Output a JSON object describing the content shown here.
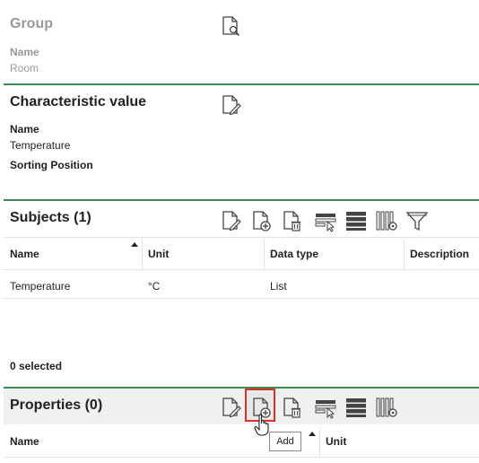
{
  "group": {
    "title": "Group",
    "name_label": "Name",
    "name_value": "Room"
  },
  "characteristic": {
    "title": "Characteristic value",
    "name_label": "Name",
    "name_value": "Temperature",
    "sorting_label": "Sorting Position"
  },
  "subjects": {
    "title": "Subjects (1)",
    "columns": [
      "Name",
      "Unit",
      "Data type",
      "Description"
    ],
    "rows": [
      {
        "name": "Temperature",
        "unit": "°C",
        "data_type": "List",
        "description": ""
      }
    ],
    "selected_text": "0 selected"
  },
  "properties": {
    "title": "Properties (0)",
    "columns": [
      "Name",
      "Unit"
    ],
    "tooltip": "Add"
  },
  "colors": {
    "accent_line": "#3a8a52",
    "highlight_border": "#d9302c"
  },
  "icons": [
    "search-document-icon",
    "edit-document-icon",
    "add-document-icon",
    "delete-document-icon",
    "select-rows-icon",
    "list-view-icon",
    "column-settings-icon",
    "filter-icon"
  ]
}
